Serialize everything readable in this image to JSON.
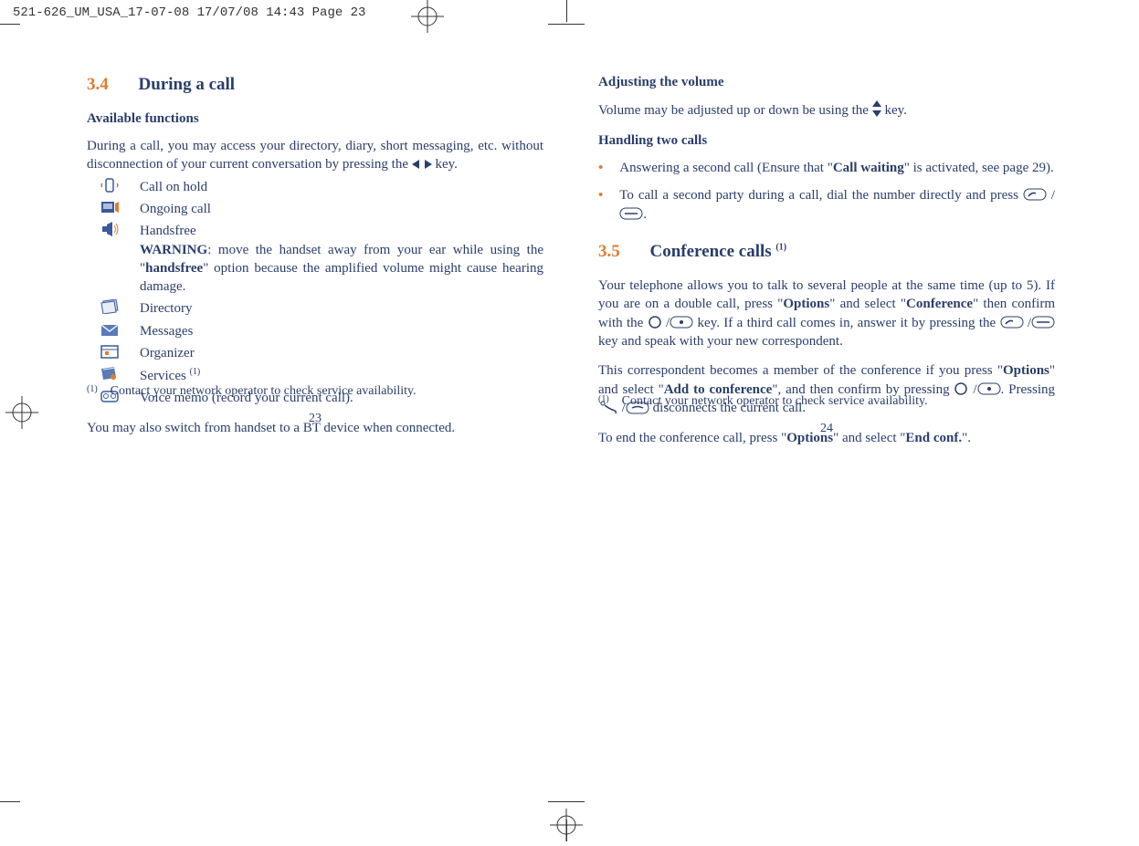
{
  "print_header": "521-626_UM_USA_17-07-08  17/07/08  14:43  Page 23",
  "left": {
    "section_num": "3.4",
    "section_title": "During a call",
    "sub1": "Available functions",
    "intro_a": "During a call, you may access your directory, diary, short messaging, etc. without disconnection of your current conversation by pressing the ",
    "intro_b": " key.",
    "items": {
      "hold": "Call on hold",
      "ongoing": "Ongoing call",
      "hands_title": "Handsfree",
      "hands_warn_label": "WARNING",
      "hands_warn_text": ": move the handset away from your ear while using the \"",
      "hands_warn_bold": "handsfree",
      "hands_warn_tail": "\" option because the amplified volume might cause hearing damage.",
      "directory": "Directory",
      "messages": "Messages",
      "organizer": "Organizer",
      "services": "Services ",
      "voicememo": "Voice memo (record your current call)."
    },
    "tail": "You may also switch from handset to a BT device when connected.",
    "footnote_sup": "(1)",
    "footnote": "Contact your network operator to check service availability.",
    "page_number": "23"
  },
  "right": {
    "sub1": "Adjusting the volume",
    "vol_a": "Volume may be adjusted up or down be using the ",
    "vol_b": " key.",
    "sub2": "Handling two calls",
    "bullet1_a": "Answering a second call (Ensure that \"",
    "bullet1_bold": "Call waiting",
    "bullet1_b": "\" is activated, see page 29).",
    "bullet2_a": "To call a second party during a call, dial the number directly and press ",
    "bullet2_b": ".",
    "section_num": "3.5",
    "section_title": "Conference calls ",
    "section_sup": "(1)",
    "p1_a": "Your telephone allows you to talk to several people at the same time (up to 5). If you are on a double call, press \"",
    "p1_b1": "Options",
    "p1_c": "\" and select \"",
    "p1_b2": "Conference",
    "p1_d": "\" then confirm with the ",
    "p1_e": " key. If a third call comes in, answer it by pressing the ",
    "p1_f": " key and speak with your new correspondent.",
    "p2_a": "This correspondent becomes a member of the conference if you press \"",
    "p2_b1": "Options",
    "p2_b": "\" and select \"",
    "p2_b2": "Add to conference",
    "p2_c": "\", and then confirm by pressing ",
    "p2_d": ". Pressing ",
    "p2_e": " disconnects the current call.",
    "p3_a": "To end the conference call, press \"",
    "p3_b1": "Options",
    "p3_b": "\" and select \"",
    "p3_b2": "End conf.",
    "p3_c": "\".",
    "footnote_sup": "(1)",
    "footnote": "Contact your network operator to check service availability.",
    "page_number": "24"
  }
}
